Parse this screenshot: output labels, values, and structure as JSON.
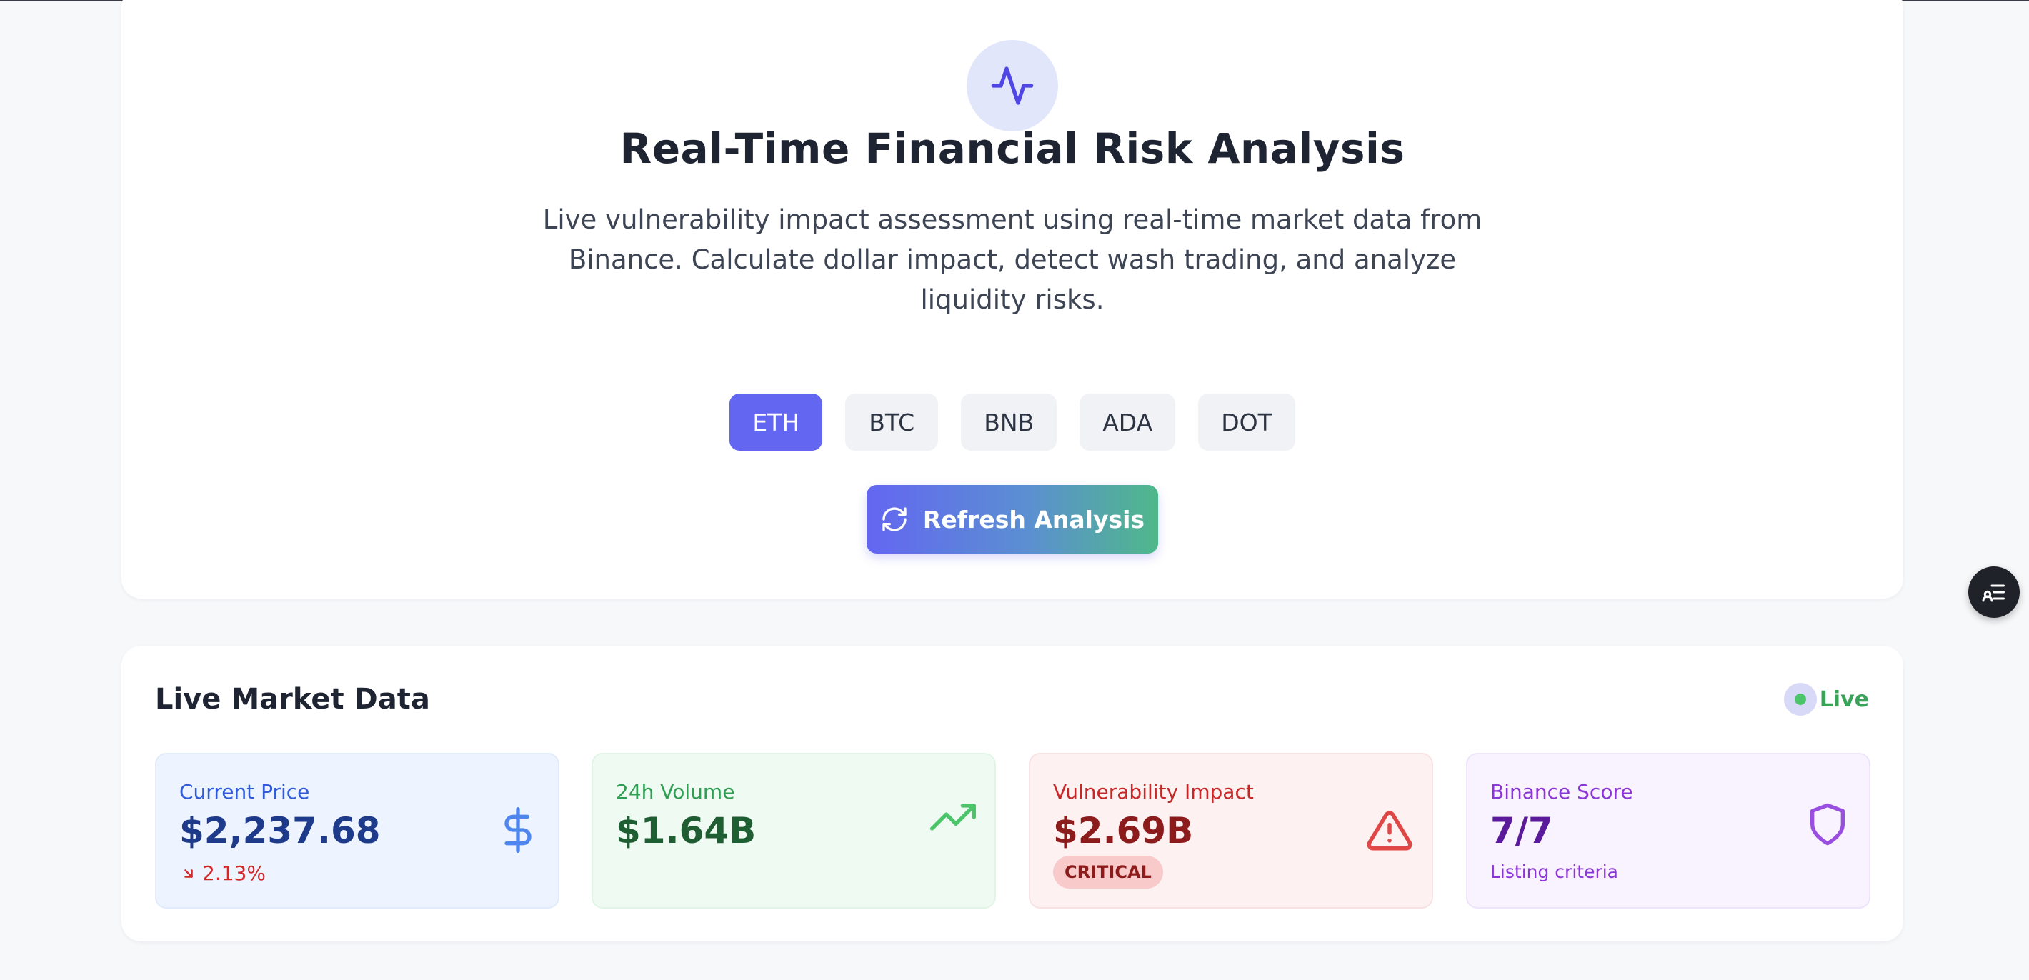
{
  "hero": {
    "icon": "activity-pulse-icon",
    "title": "Real-Time Financial Risk Analysis",
    "description": "Live vulnerability impact assessment using real-time market data from Binance. Calculate dollar impact, detect wash trading, and analyze liquidity risks.",
    "tokens": [
      "ETH",
      "BTC",
      "BNB",
      "ADA",
      "DOT"
    ],
    "selected_token": "ETH",
    "refresh_label": "Refresh Analysis",
    "refresh_icon": "refresh-icon"
  },
  "market": {
    "title": "Live Market Data",
    "live_label": "Live",
    "metrics": [
      {
        "label": "Current Price",
        "value": "$2,237.68",
        "change": "2.13%",
        "change_direction": "down",
        "icon": "dollar-icon"
      },
      {
        "label": "24h Volume",
        "value": "$1.64B",
        "icon": "trending-up-icon"
      },
      {
        "label": "Vulnerability Impact",
        "value": "$2.69B",
        "badge": "CRITICAL",
        "icon": "alert-triangle-icon"
      },
      {
        "label": "Binance Score",
        "value": "7/7",
        "sub": "Listing criteria",
        "icon": "shield-icon"
      }
    ]
  },
  "colors": {
    "accent": "#6366f1",
    "live_green": "#4cc46a",
    "critical_red": "#c62828"
  },
  "floating_button": {
    "icon": "list-settings-icon"
  }
}
